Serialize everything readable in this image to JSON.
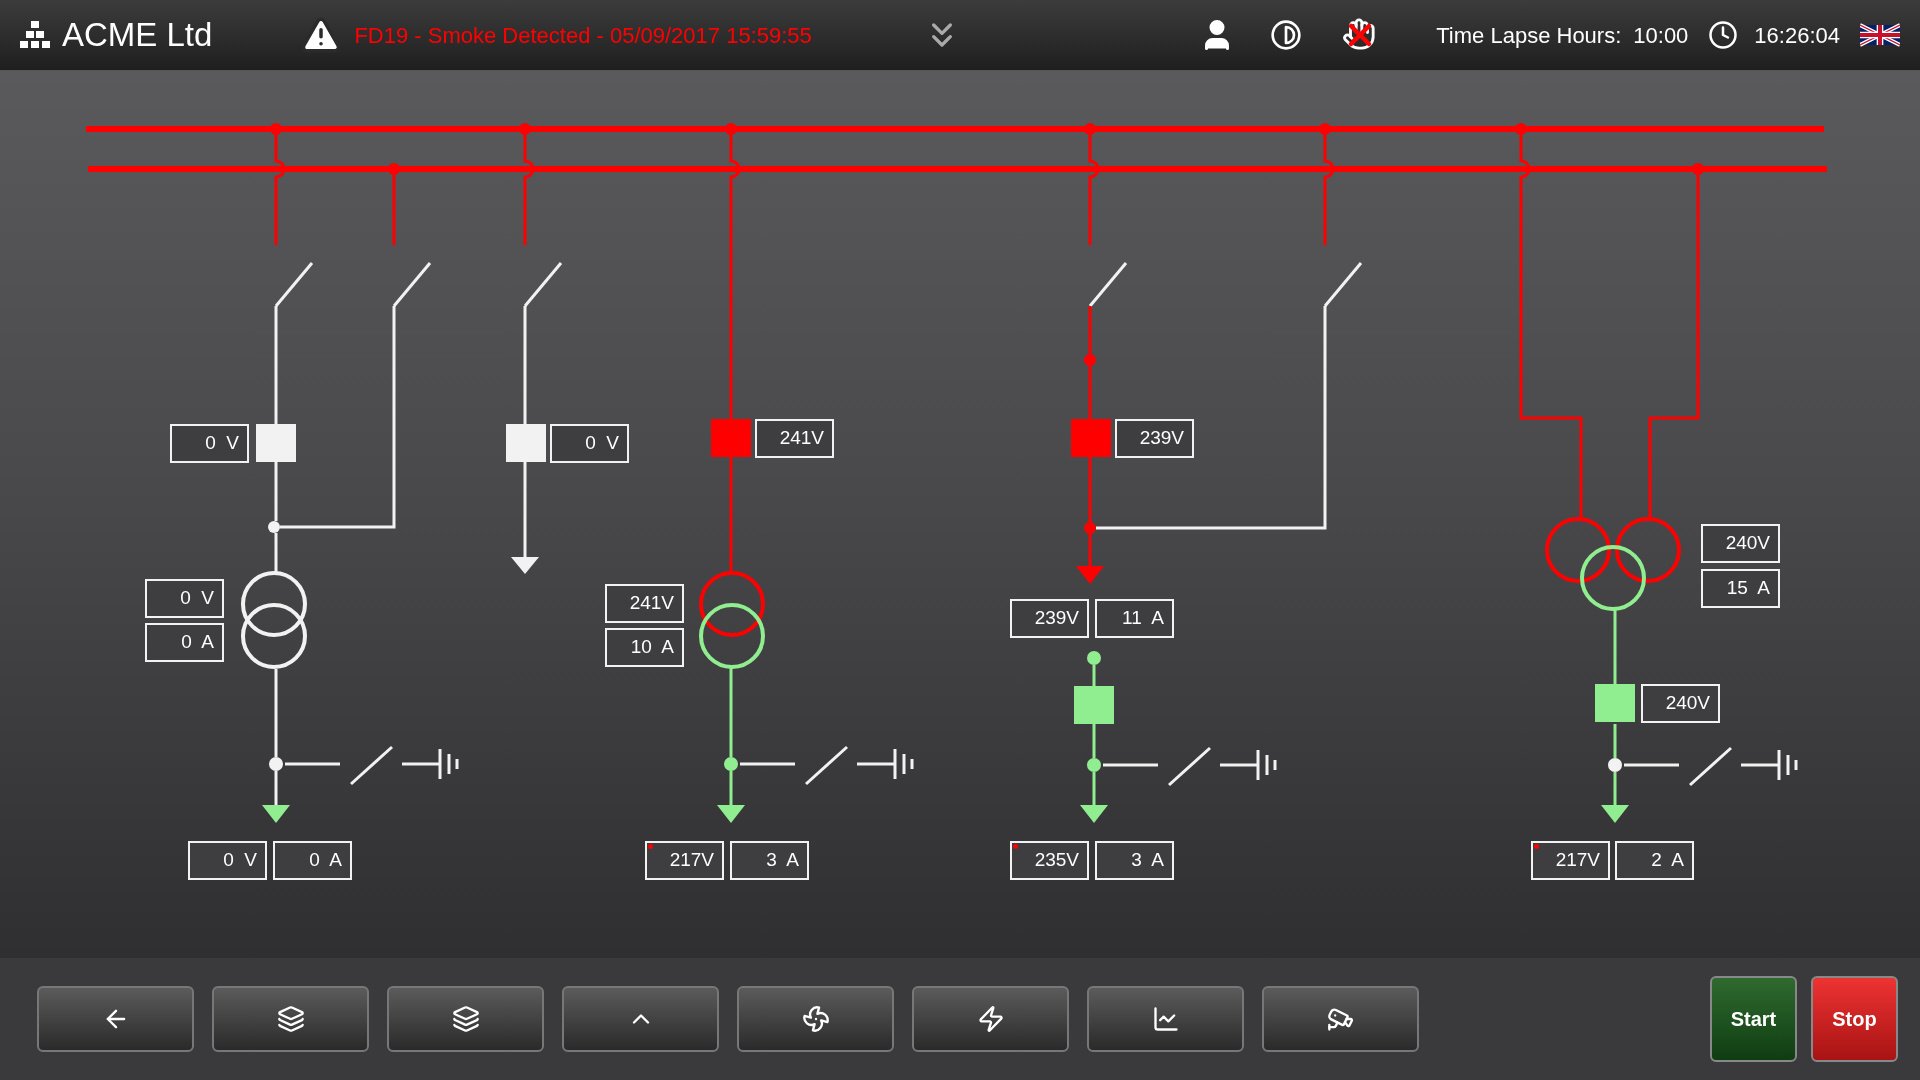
{
  "header": {
    "company": "ACME Ltd",
    "alarm": "FD19 - Smoke Detected - 05/09/2017 15:59:55",
    "time_lapse_label": "Time Lapse Hours:",
    "time_lapse_value": "10:00",
    "clock": "16:26:04"
  },
  "readouts": [
    {
      "text": "0  V",
      "flag": false
    },
    {
      "text": "0  V",
      "flag": false
    },
    {
      "text": "241V",
      "flag": false
    },
    {
      "text": "239V",
      "flag": false
    },
    {
      "text": "0  V",
      "flag": false
    },
    {
      "text": "0  A",
      "flag": false
    },
    {
      "text": "241V",
      "flag": false
    },
    {
      "text": "10  A",
      "flag": false
    },
    {
      "text": "239V",
      "flag": false
    },
    {
      "text": "11  A",
      "flag": false
    },
    {
      "text": "240V",
      "flag": false
    },
    {
      "text": "15  A",
      "flag": false
    },
    {
      "text": "240V",
      "flag": false
    },
    {
      "text": "0  V",
      "flag": false
    },
    {
      "text": "0  A",
      "flag": false
    },
    {
      "text": "217V",
      "flag": true
    },
    {
      "text": "3  A",
      "flag": false
    },
    {
      "text": "235V",
      "flag": true
    },
    {
      "text": "3  A",
      "flag": false
    },
    {
      "text": "217V",
      "flag": true
    },
    {
      "text": "2  A",
      "flag": false
    }
  ],
  "controls": [
    {
      "label": "Start",
      "kind": "start"
    },
    {
      "label": "Stop",
      "kind": "stop"
    }
  ]
}
